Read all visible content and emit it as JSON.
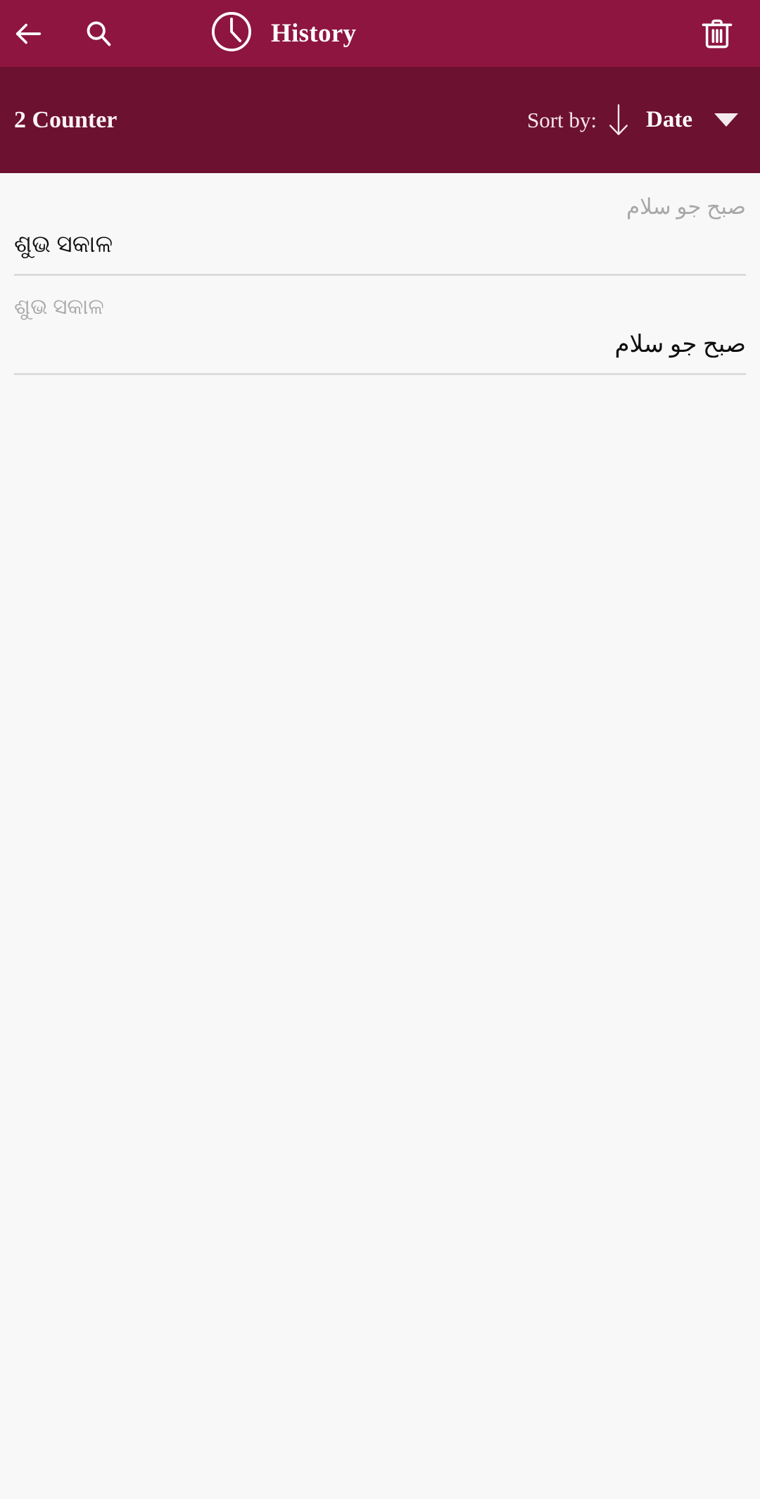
{
  "theme": {
    "appbar_color": "#8e1540",
    "sortbar_color": "#6d1130",
    "content_bg": "#f8f8f8",
    "divider_color": "#dcdcdc",
    "source_text_color": "#a8a8a8",
    "target_text_color": "#0e0e0e",
    "on_primary_color": "#ffffff"
  },
  "appbar": {
    "back_icon": "back-arrow-icon",
    "search_icon": "search-icon",
    "title_icon": "clock-icon",
    "title": "History",
    "delete_icon": "trash-icon"
  },
  "sortbar": {
    "counter_label": "2 Counter",
    "sort_by_label": "Sort by:",
    "sort_direction_icon": "arrow-down-icon",
    "sort_value": "Date",
    "dropdown_icon": "caret-down-icon"
  },
  "history": {
    "items": [
      {
        "source_text": "صبح جو سلام",
        "source_dir": "rtl",
        "target_text": "ଶୁଭ ସକାଳ",
        "target_dir": "ltr"
      },
      {
        "source_text": "ଶୁଭ ସକାଳ",
        "source_dir": "ltr",
        "target_text": "صبح جو سلام",
        "target_dir": "rtl"
      }
    ]
  }
}
